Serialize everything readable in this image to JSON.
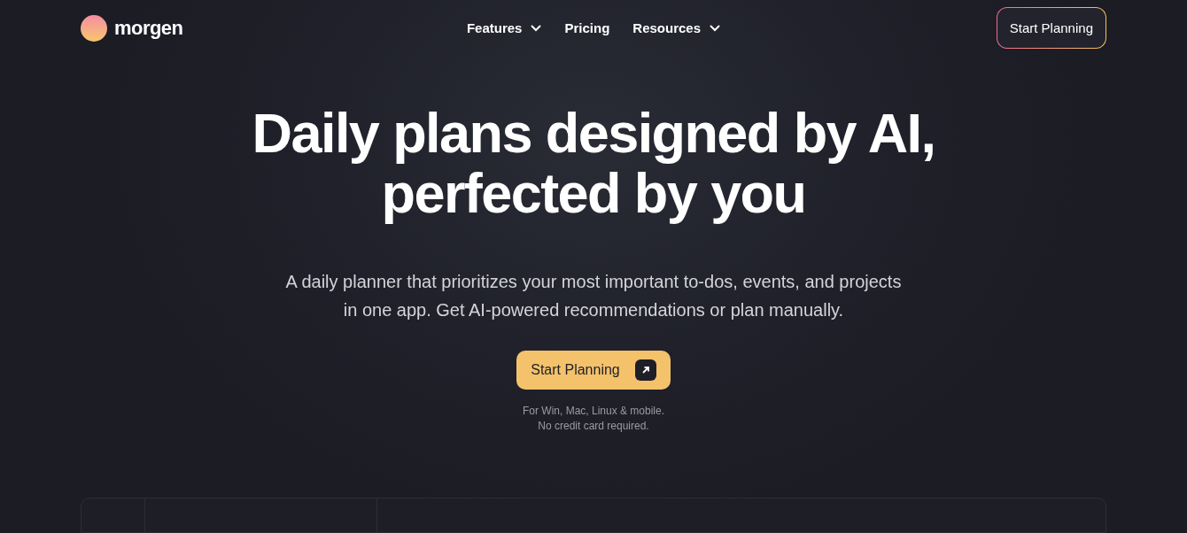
{
  "logo": {
    "name": "morgen"
  },
  "nav": [
    {
      "label": "Features",
      "dropdown": true
    },
    {
      "label": "Pricing",
      "dropdown": false
    },
    {
      "label": "Resources",
      "dropdown": true
    }
  ],
  "header_cta": "Start Planning",
  "hero": {
    "title_lines": [
      "Daily plans designed by AI,",
      "perfected by you"
    ],
    "subtitle_lines": [
      "A daily planner that prioritizes your most important to-dos, events, and projects",
      "in one app. Get AI-powered recommendations or plan manually."
    ],
    "cta": "Start Planning",
    "notes": [
      "For Win, Mac, Linux & mobile.",
      "No credit card required."
    ]
  }
}
